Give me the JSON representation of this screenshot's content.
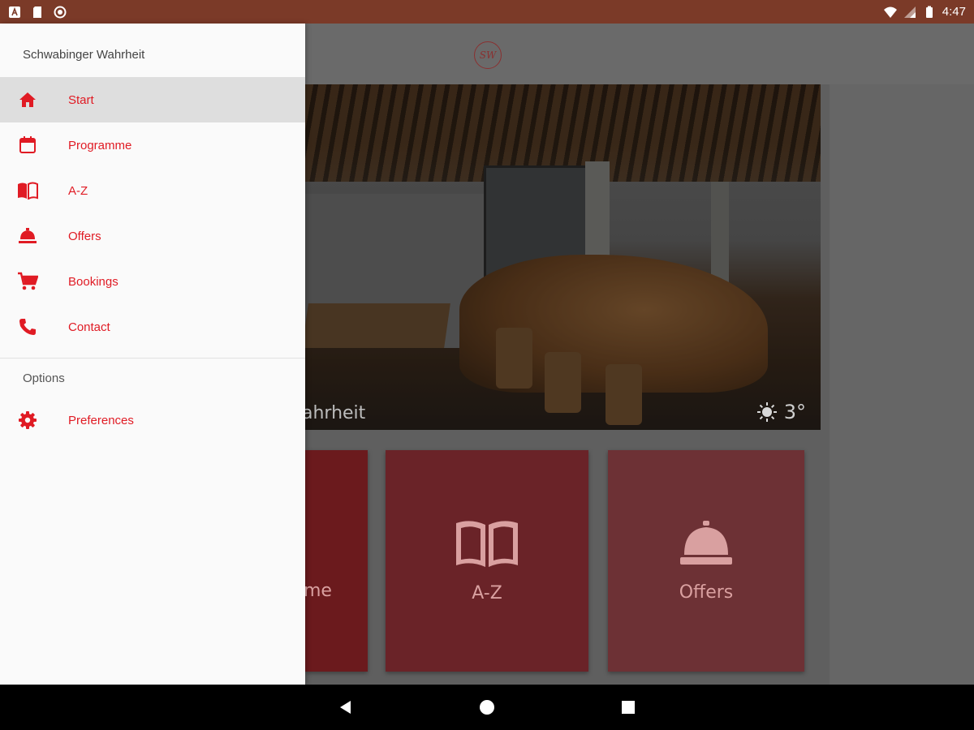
{
  "status_bar": {
    "time": "4:47"
  },
  "app": {
    "logo_text": "SW",
    "hero": {
      "caption": "ahrheit",
      "temperature": "3°"
    },
    "tiles": [
      {
        "label": "me",
        "icon": "calendar-icon"
      },
      {
        "label": "A-Z",
        "icon": "open-book-icon"
      },
      {
        "label": "Offers",
        "icon": "service-bell-icon"
      }
    ]
  },
  "drawer": {
    "title": "Schwabinger Wahrheit",
    "items": [
      {
        "label": "Start",
        "icon": "home-icon",
        "active": true
      },
      {
        "label": "Programme",
        "icon": "calendar-icon"
      },
      {
        "label": "A-Z",
        "icon": "book-icon"
      },
      {
        "label": "Offers",
        "icon": "service-bell-icon"
      },
      {
        "label": "Bookings",
        "icon": "cart-icon"
      },
      {
        "label": "Contact",
        "icon": "phone-icon"
      }
    ],
    "options_title": "Options",
    "options_items": [
      {
        "label": "Preferences",
        "icon": "gear-icon"
      }
    ]
  },
  "colors": {
    "accent": "#e01b24",
    "status_bar": "#7b3a28"
  }
}
